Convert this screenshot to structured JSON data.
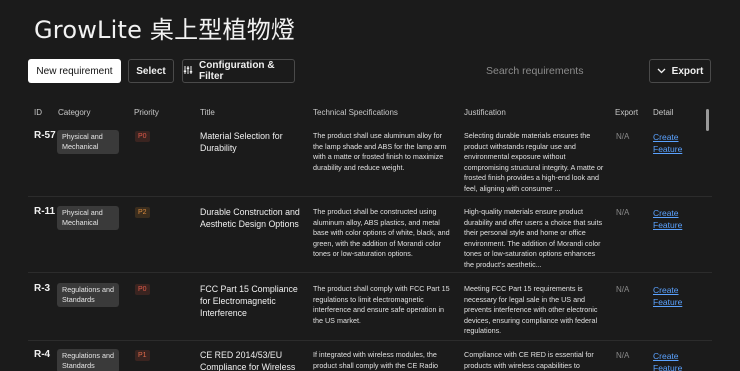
{
  "page": {
    "title": "GrowLite 桌上型植物燈"
  },
  "toolbar": {
    "new_label": "New requirement",
    "select_label": "Select",
    "config_label": "Configuration & Filter",
    "search_placeholder": "Search requirements",
    "export_label": "Export"
  },
  "columns": {
    "id": "ID",
    "category": "Category",
    "priority": "Priority",
    "title": "Title",
    "spec": "Technical Specifications",
    "just": "Justification",
    "export": "Export",
    "detail": "Detail"
  },
  "rows": [
    {
      "id": "R-57",
      "category": "Physical and Mechanical",
      "priority": "P0",
      "priority_color": "#e05a4a",
      "title": "Material Selection for Durability",
      "spec": "The product shall use aluminum alloy for the lamp shade and ABS for the lamp arm with a matte or frosted finish to maximize durability and reduce weight.",
      "just": "Selecting durable materials ensures the product withstands regular use and environmental exposure without compromising structural integrity. A matte or frosted finish provides a high-end look and feel, aligning with consumer ...",
      "export": "N/A",
      "detail": "Create Feature Workspace"
    },
    {
      "id": "R-11",
      "category": "Physical and Mechanical",
      "priority": "P2",
      "priority_color": "#d98a3d",
      "title": "Durable Construction and Aesthetic Design Options",
      "spec": "The product shall be constructed using aluminum alloy, ABS plastics, and metal base with color options of white, black, and green, with the addition of Morandi color tones or low-saturation options.",
      "just": "High-quality materials ensure product durability and offer users a choice that suits their personal style and home or office environment. The addition of Morandi color tones or low-saturation options enhances the product's aesthetic...",
      "export": "N/A",
      "detail": "Create Feature Workspace"
    },
    {
      "id": "R-3",
      "category": "Regulations and Standards",
      "priority": "P0",
      "priority_color": "#e05a4a",
      "title": "FCC Part 15 Compliance for Electromagnetic Interference",
      "spec": "The product shall comply with FCC Part 15 regulations to limit electromagnetic interference and ensure safe operation in the US market.",
      "just": "Meeting FCC Part 15 requirements is necessary for legal sale in the US and prevents interference with other electronic devices, ensuring compliance with federal regulations.",
      "export": "N/A",
      "detail": "Create Feature Workspace"
    },
    {
      "id": "R-4",
      "category": "Regulations and Standards",
      "priority": "P1",
      "priority_color": "#e06a4a",
      "title": "CE RED 2014/53/EU Compliance for Wireless",
      "spec": "If integrated with wireless modules, the product shall comply with the CE Radio",
      "just": "Compliance with CE RED is essential for products with wireless capabilities to",
      "export": "N/A",
      "detail": "Create Feature Workspace"
    }
  ],
  "icons": {
    "config": "sliders-icon",
    "export": "chevron-down-icon"
  }
}
